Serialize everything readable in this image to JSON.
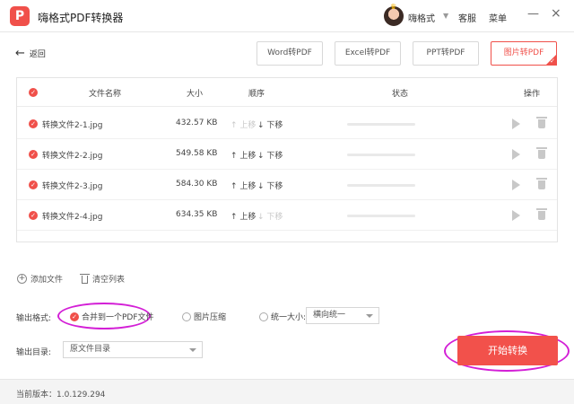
{
  "app": {
    "title": "嗨格式PDF转换器",
    "logo_letter": "P"
  },
  "titlebar": {
    "username": "嗨格式",
    "service": "客服",
    "menu": "菜单",
    "minimize": "—",
    "close": "×"
  },
  "nav": {
    "back_label": "返回"
  },
  "tabs": [
    {
      "label": "Word转PDF",
      "active": false
    },
    {
      "label": "Excel转PDF",
      "active": false
    },
    {
      "label": "PPT转PDF",
      "active": false
    },
    {
      "label": "图片转PDF",
      "active": true
    }
  ],
  "table": {
    "headers": {
      "name": "文件名称",
      "size": "大小",
      "order": "顺序",
      "status": "状态",
      "action": "操作"
    },
    "move_up": "↑ 上移",
    "move_down": "↓ 下移",
    "rows": [
      {
        "name": "转换文件2-1.jpg",
        "size": "432.57 KB",
        "up_enabled": false,
        "down_enabled": true,
        "progress": 0
      },
      {
        "name": "转换文件2-2.jpg",
        "size": "549.58 KB",
        "up_enabled": true,
        "down_enabled": true,
        "progress": 0
      },
      {
        "name": "转换文件2-3.jpg",
        "size": "584.30 KB",
        "up_enabled": true,
        "down_enabled": true,
        "progress": 0
      },
      {
        "name": "转换文件2-4.jpg",
        "size": "634.35 KB",
        "up_enabled": true,
        "down_enabled": false,
        "progress": 0
      }
    ]
  },
  "actions": {
    "add_file": "添加文件",
    "clear_list": "清空列表"
  },
  "output": {
    "format_label": "输出格式:",
    "options": [
      {
        "label": "合并到一个PDF文件",
        "checked": true
      },
      {
        "label": "图片压缩",
        "checked": false
      },
      {
        "label": "统一大小:",
        "checked": false
      }
    ],
    "size_select": "横向统一",
    "dir_label": "输出目录:",
    "dir_select": "原文件目录"
  },
  "start_button": "开始转换",
  "footer": {
    "version": "当前版本：1.0.129.294"
  },
  "colors": {
    "accent": "#f0504a",
    "highlight": "#d31fd6"
  }
}
